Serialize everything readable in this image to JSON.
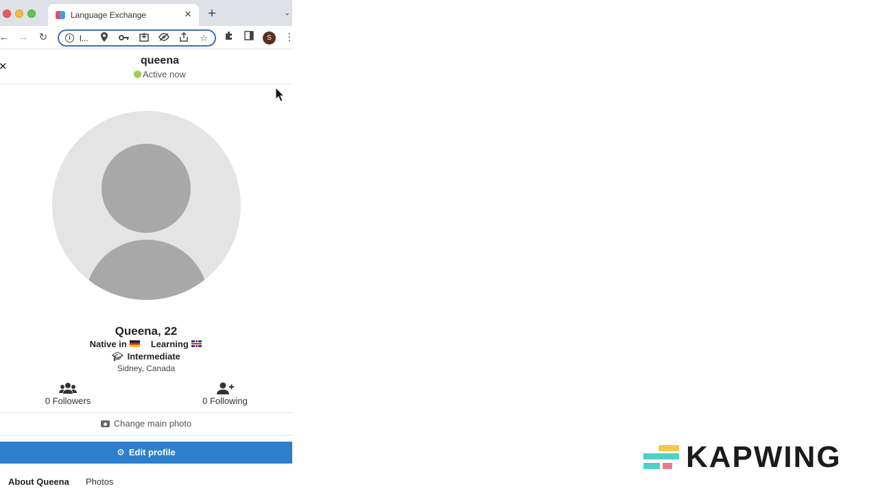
{
  "browser": {
    "tab_title": "Language Exchange",
    "url": "l...",
    "new_tab_symbol": "+",
    "profile_initial": "S"
  },
  "header": {
    "username": "queena",
    "status": "Active now",
    "close_symbol": "✕"
  },
  "profile": {
    "name_age": "Queena, 22",
    "native_label": "Native in",
    "learning_label": "Learning",
    "level": "Intermediate",
    "location": "Sidney, Canada",
    "followers": "0 Followers",
    "following": "0 Following"
  },
  "actions": {
    "change_photo": "Change main photo",
    "edit_profile": "Edit profile"
  },
  "tabs": [
    {
      "label": "About Queena"
    },
    {
      "label": "Photos"
    }
  ],
  "watermark": {
    "text": "KAPWING"
  },
  "colors": {
    "primary_button": "#2d7fcb",
    "status_online": "#9ccc55",
    "avatar_bg": "#e4e4e4",
    "avatar_figure": "#a8a8a8"
  }
}
